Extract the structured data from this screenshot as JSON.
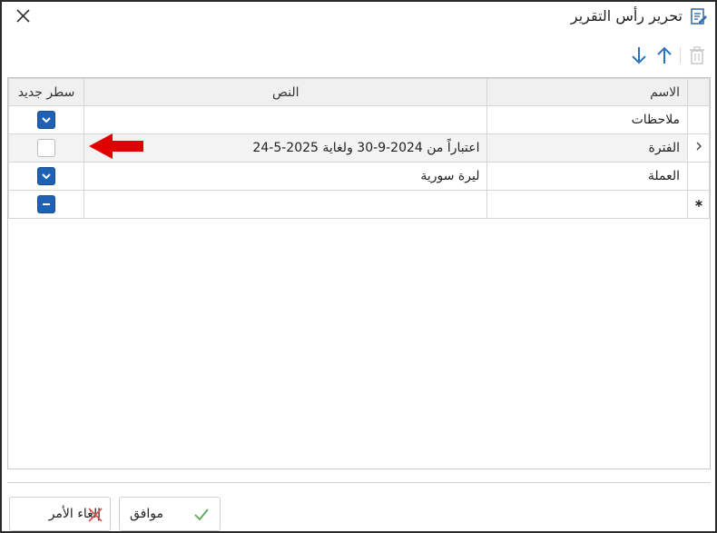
{
  "dialog": {
    "title": "تحرير رأس التقرير"
  },
  "table": {
    "columns": {
      "name": "الاسم",
      "text": "النص",
      "new_line": "سطر جديد"
    },
    "rows": [
      {
        "name": "ملاحظات",
        "text": "",
        "new_line": "checked"
      },
      {
        "name": "الفترة",
        "text": "اعتباراً من 2024-9-30 ولغاية 2025-5-24",
        "new_line": "unchecked"
      },
      {
        "name": "العملة",
        "text": "ليرة سورية",
        "new_line": "checked"
      },
      {
        "name": "",
        "text": "",
        "new_line": "indeterminate"
      }
    ],
    "new_row_marker": "*",
    "current_row_marker": "›"
  },
  "buttons": {
    "ok": "موافق",
    "cancel": "إلغاء الأمر"
  },
  "colors": {
    "accent": "#1f62b3",
    "arrow_annotation": "#e00000",
    "ok_icon": "#5aa85a",
    "cancel_icon": "#d9534f"
  }
}
